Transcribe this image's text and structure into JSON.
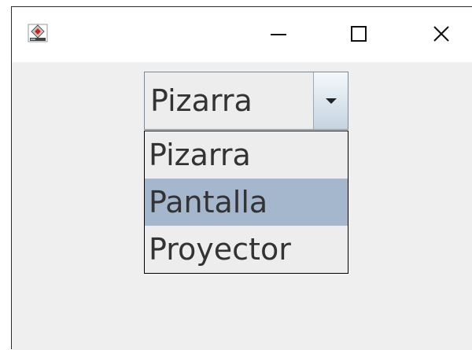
{
  "window": {
    "icon": "java-app-icon",
    "controls": {
      "minimize_icon": "minimize-icon",
      "maximize_icon": "maximize-icon",
      "close_icon": "close-icon"
    }
  },
  "combo": {
    "selected_value": "Pizarra",
    "arrow_icon": "chevron-down-icon",
    "options": [
      {
        "label": "Pizarra",
        "highlighted": false
      },
      {
        "label": "Pantalla",
        "highlighted": true
      },
      {
        "label": "Proyector",
        "highlighted": false
      }
    ]
  },
  "colors": {
    "highlight": "#a4b7cc",
    "window_bg": "#efefef",
    "titlebar_bg": "#ffffff"
  }
}
